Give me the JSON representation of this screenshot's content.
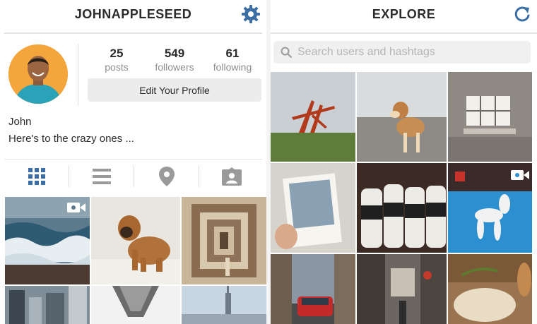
{
  "profile": {
    "header": {
      "title": "JOHNAPPLESEED"
    },
    "stats": [
      {
        "value": "25",
        "label": "posts"
      },
      {
        "value": "549",
        "label": "followers"
      },
      {
        "value": "61",
        "label": "following"
      }
    ],
    "edit_button": "Edit Your Profile",
    "name": "John",
    "bio": "Here's to the crazy ones ...",
    "tabs": [
      "grid-icon",
      "list-icon",
      "location-pin-icon",
      "tagged-photos-icon"
    ]
  },
  "explore": {
    "header": {
      "title": "EXPLORE"
    },
    "search": {
      "placeholder": "Search users and hashtags"
    }
  },
  "colors": {
    "accent": "#3a6ea5",
    "text": "#2b2b2b",
    "muted": "#8f8f8f"
  }
}
